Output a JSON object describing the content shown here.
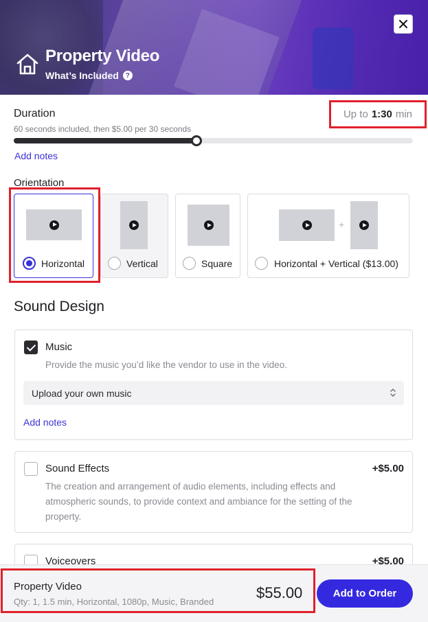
{
  "header": {
    "title": "Property Video",
    "subtitle": "What’s Included",
    "help_glyph": "?",
    "close_glyph": "✕",
    "icons": {
      "home": "home-icon",
      "help": "question-circle-icon",
      "close": "close-icon"
    }
  },
  "duration": {
    "label": "Duration",
    "hint": "60 seconds included, then $5.00 per 30 seconds",
    "max_prefix": "Up to",
    "max_value": "1:30",
    "max_suffix": "min",
    "slider_fraction": 0.458,
    "add_notes": "Add notes"
  },
  "orientation": {
    "label": "Orientation",
    "options": [
      {
        "label": "Horizontal",
        "selected": true
      },
      {
        "label": "Vertical",
        "selected": false
      },
      {
        "label": "Square",
        "selected": false
      },
      {
        "label": "Horizontal + Vertical ($13.00)",
        "selected": false
      }
    ],
    "plus_glyph": "+"
  },
  "sound_design": {
    "heading": "Sound Design",
    "music": {
      "title": "Music",
      "checked": true,
      "description": "Provide the music you’d like the vendor to use in the video.",
      "select_value": "Upload your own music",
      "add_notes": "Add notes"
    },
    "sound_effects": {
      "title": "Sound Effects",
      "checked": false,
      "price": "+$5.00",
      "description_lines": [
        "The creation and arrangement of audio elements, including effects and",
        "atmospheric sounds, to provide context and ambiance for the setting of the",
        "property."
      ]
    },
    "voiceovers": {
      "title": "Voiceovers",
      "checked": false,
      "price": "+$5.00"
    }
  },
  "footer": {
    "title": "Property Video",
    "summary": "Qty: 1, 1.5 min, Horizontal, 1080p, Music, Branded",
    "price": "$55.00",
    "button": "Add to Order"
  },
  "colors": {
    "accent": "#3529e0",
    "highlight": "#e0202b",
    "header_purple": "#6a4fb0"
  }
}
